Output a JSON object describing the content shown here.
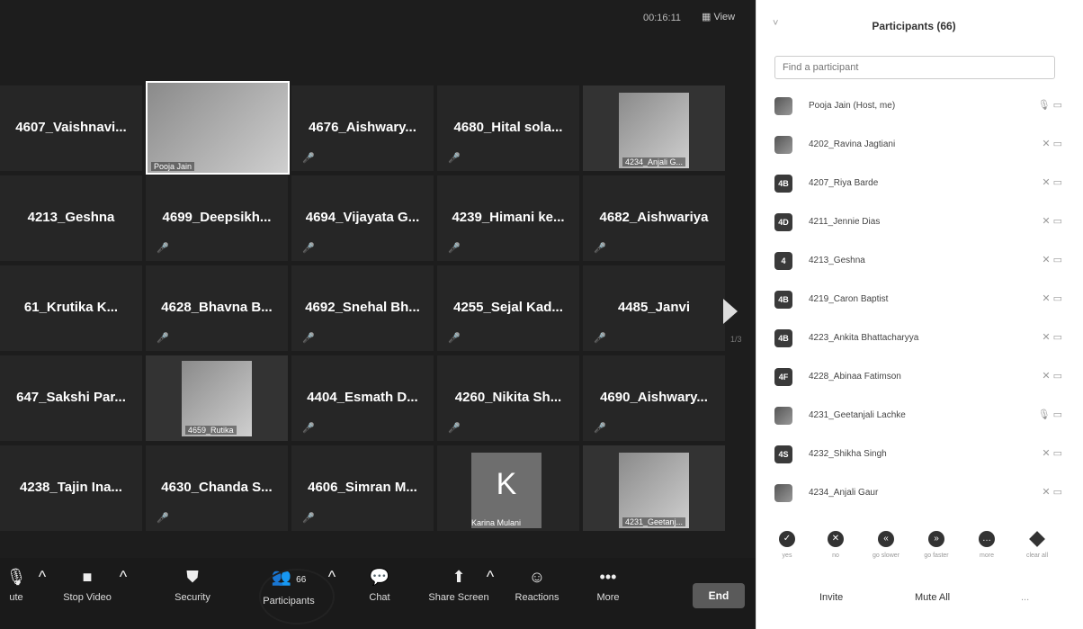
{
  "header": {
    "timer": "00:16:11",
    "view_label": "View"
  },
  "tiles": [
    {
      "name": "4607_Vaishnavi..."
    },
    {
      "name": "",
      "video_caption": "Pooja Jain"
    },
    {
      "name": "4676_Aishwary..."
    },
    {
      "name": "4680_Hital sola..."
    },
    {
      "name": "",
      "video_caption": "4234_Anjali G..."
    },
    {
      "name": "4213_Geshna"
    },
    {
      "name": "4699_Deepsikh..."
    },
    {
      "name": "4694_Vijayata G..."
    },
    {
      "name": "4239_Himani ke..."
    },
    {
      "name": "4682_Aishwariya"
    },
    {
      "name": "61_Krutika K..."
    },
    {
      "name": "4628_Bhavna B..."
    },
    {
      "name": "4692_Snehal Bh..."
    },
    {
      "name": "4255_Sejal Kad..."
    },
    {
      "name": "4485_Janvi"
    },
    {
      "name": "647_Sakshi Par..."
    },
    {
      "name": "",
      "video_caption": "4659_Rutika"
    },
    {
      "name": "4404_Esmath D..."
    },
    {
      "name": "4260_Nikita Sh..."
    },
    {
      "name": "4690_Aishwary..."
    },
    {
      "name": "4238_Tajin Ina..."
    },
    {
      "name": "4630_Chanda S..."
    },
    {
      "name": "4606_Simran M..."
    },
    {
      "name": "",
      "avatar_letter": "K",
      "video_caption": "Karina Mulani"
    },
    {
      "name": "",
      "video_caption": "4231_Geetanj..."
    }
  ],
  "page_indicator": "1/3",
  "toolbar": {
    "mute": "ute",
    "stop_video": "Stop Video",
    "security": "Security",
    "participants": "Participants",
    "participants_count": "66",
    "chat": "Chat",
    "share_screen": "Share Screen",
    "reactions": "Reactions",
    "more": "More",
    "end": "End"
  },
  "panel": {
    "title": "Participants (66)",
    "search_placeholder": "Find a participant",
    "participants": [
      {
        "name": "Pooja Jain (Host, me)",
        "avatar": ""
      },
      {
        "name": "4202_Ravina Jagtiani",
        "avatar": ""
      },
      {
        "name": "4207_Riya Barde",
        "avatar": "4B"
      },
      {
        "name": "4211_Jennie Dias",
        "avatar": "4D"
      },
      {
        "name": "4213_Geshna",
        "avatar": "4"
      },
      {
        "name": "4219_Caron Baptist",
        "avatar": "4B"
      },
      {
        "name": "4223_Ankita Bhattacharyya",
        "avatar": "4B"
      },
      {
        "name": "4228_Abinaa Fatimson",
        "avatar": "4F"
      },
      {
        "name": "4231_Geetanjali Lachke",
        "avatar": ""
      },
      {
        "name": "4232_Shikha Singh",
        "avatar": "4S"
      },
      {
        "name": "4234_Anjali Gaur",
        "avatar": ""
      }
    ],
    "reactions": [
      "yes",
      "no",
      "go slower",
      "go faster",
      "more",
      "clear all"
    ],
    "invite": "Invite",
    "mute_all": "Mute All",
    "more_menu": "..."
  }
}
